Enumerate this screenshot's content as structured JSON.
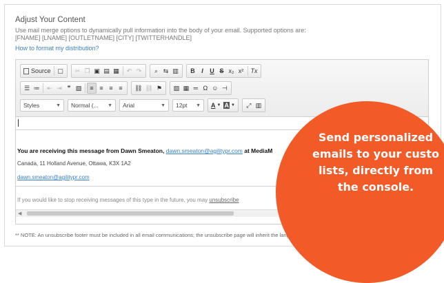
{
  "header": {
    "title": "Adjust Your Content",
    "description": "Use mail merge options to dynamically pull information into the body of your email. Supported options are:",
    "merge_tags": "[FNAME] [LNAME] [OUTLETNAME] [CITY] [TWITTERHANDLE]",
    "help_link": "How to format my distribution?"
  },
  "toolbar": {
    "source_label": "Source",
    "styles_label": "Styles",
    "format_label": "Normal (...",
    "font_label": "Arial",
    "size_label": "12pt",
    "bold": "B",
    "italic": "I",
    "underline": "U",
    "strike": "S",
    "subscript": "x₂",
    "superscript": "x²",
    "clear_format": "Tx",
    "omega": "Ω",
    "text_color": "A",
    "bg_color": "A"
  },
  "editor": {
    "message_prefix": "You are receiving this message from Dawn Smeaton,",
    "message_email": "dawn.smeaton@agilitypr.com",
    "message_suffix": "at MediaM",
    "address": "Canada, 11 Holland Avenue, Ottawa, K3X 1A2",
    "email_link": "dawn.smeaton@agilitypr.com",
    "unsubscribe_text": "If you would like to stop receiving messages of this type in the future, you may",
    "unsubscribe_link": "unsubscribe"
  },
  "note": "** NOTE: An unsubscribe footer must be included in all email communications; the unsubscribe page will inherit the language",
  "promo": {
    "line1": "Send personalized",
    "line2": "emails to your custo",
    "line3": "lists, directly from",
    "line4": "the console."
  },
  "colors": {
    "accent": "#f25a27",
    "link": "#3a7fc1"
  }
}
